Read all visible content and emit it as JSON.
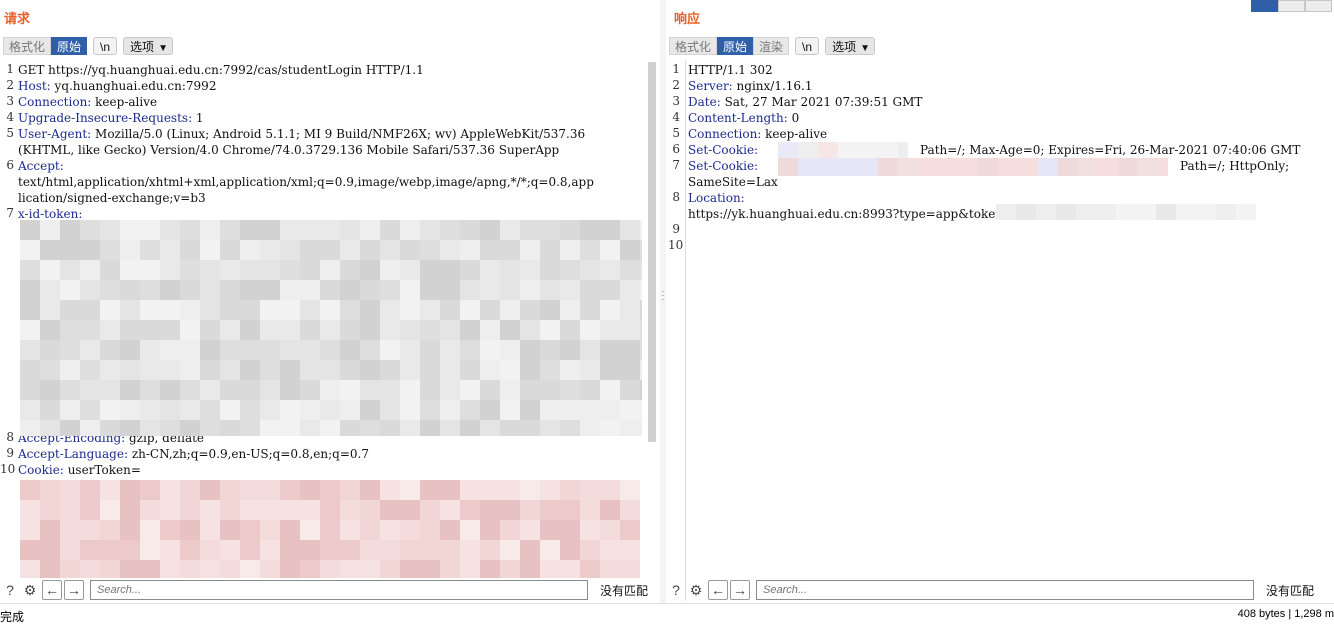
{
  "request": {
    "title": "请求",
    "tabs": [
      "格式化",
      "原始"
    ],
    "newline_label": "\\n",
    "options_label": "选项",
    "lines": [
      {
        "num": "1",
        "key": "",
        "value": "GET https://yq.huanghuai.edu.cn:7992/cas/studentLogin HTTP/1.1"
      },
      {
        "num": "2",
        "key": "Host:",
        "value": " yq.huanghuai.edu.cn:7992"
      },
      {
        "num": "3",
        "key": "Connection:",
        "value": " keep-alive"
      },
      {
        "num": "4",
        "key": "Upgrade-Insecure-Requests:",
        "value": " 1"
      },
      {
        "num": "5",
        "key": "User-Agent:",
        "value": " Mozilla/5.0 (Linux; Android 5.1.1; MI 9 Build/NMF26X; wv) AppleWebKit/537.36"
      },
      {
        "num": "",
        "key": "",
        "value": "(KHTML, like Gecko) Version/4.0 Chrome/74.0.3729.136 Mobile Safari/537.36 SuperApp"
      },
      {
        "num": "6",
        "key": "Accept:",
        "value": ""
      },
      {
        "num": "",
        "key": "",
        "value": "text/html,application/xhtml+xml,application/xml;q=0.9,image/webp,image/apng,*/*;q=0.8,app"
      },
      {
        "num": "",
        "key": "",
        "value": "lication/signed-exchange;v=b3"
      },
      {
        "num": "7",
        "key": "x-id-token:",
        "value": ""
      },
      {
        "num": "8",
        "key": "Accept-Encoding:",
        "value": " gzip, deflate"
      },
      {
        "num": "9",
        "key": "Accept-Language:",
        "value": " zh-CN,zh;q=0.9,en-US;q=0.8,en;q=0.7"
      },
      {
        "num": "10",
        "key": "Cookie:",
        "value": " userToken="
      }
    ],
    "search_placeholder": "Search...",
    "match_label": "没有匹配"
  },
  "response": {
    "title": "响应",
    "tabs": [
      "格式化",
      "原始",
      "渲染"
    ],
    "newline_label": "\\n",
    "options_label": "选项",
    "lines": [
      {
        "num": "1",
        "key": "",
        "value": "HTTP/1.1 302"
      },
      {
        "num": "2",
        "key": "Server:",
        "value": " nginx/1.16.1"
      },
      {
        "num": "3",
        "key": "Date:",
        "value": " Sat, 27 Mar 2021 07:39:51 GMT"
      },
      {
        "num": "4",
        "key": "Content-Length:",
        "value": " 0"
      },
      {
        "num": "5",
        "key": "Connection:",
        "value": " keep-alive"
      },
      {
        "num": "6",
        "key": "Set-Cookie:",
        "value": "Path=/; Max-Age=0; Expires=Fri, 26-Mar-2021 07:40:06 GMT"
      },
      {
        "num": "7",
        "key": "Set-Cookie:",
        "value": "Path=/; HttpOnly;"
      },
      {
        "num": "",
        "key": "",
        "value": "SameSite=Lax"
      },
      {
        "num": "8",
        "key": "Location:",
        "value": ""
      },
      {
        "num": "",
        "key": "",
        "value": "https://yk.huanghuai.edu.cn:8993?type=app&token="
      },
      {
        "num": "9",
        "key": "",
        "value": ""
      },
      {
        "num": "10",
        "key": "",
        "value": ""
      }
    ],
    "search_placeholder": "Search...",
    "match_label": "没有匹配"
  },
  "status": {
    "left": "完成",
    "right": "408 bytes | 1,298 m"
  },
  "icons": {
    "help": "help-icon",
    "settings": "gear-icon",
    "prev": "arrow-left-icon",
    "next": "arrow-right-icon"
  },
  "colors": {
    "title": "#e8612c",
    "active_tab": "#2f5fa8",
    "header_key": "#1c2b8f"
  }
}
